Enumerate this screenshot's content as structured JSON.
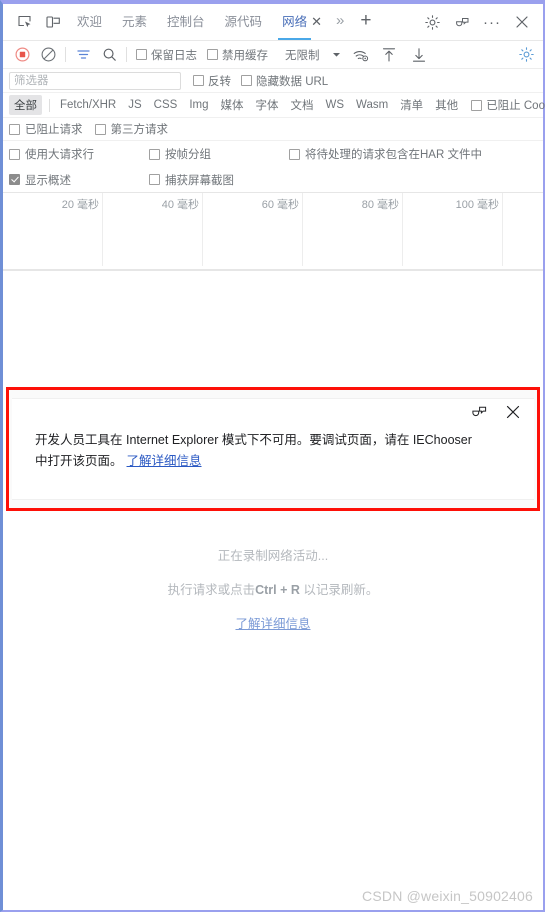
{
  "window": {
    "tabbar": {
      "inspect_icon": "inspect-element-icon",
      "device_icon": "device-emulation-icon",
      "tabs": [
        {
          "label": "欢迎",
          "active": false
        },
        {
          "label": "元素",
          "active": false
        },
        {
          "label": "控制台",
          "active": false
        },
        {
          "label": "源代码",
          "active": false
        },
        {
          "label": "网络",
          "active": true
        }
      ],
      "close_tab_glyph": "✕",
      "more_tabs_glyph": "»",
      "add_tab_glyph": "+",
      "settings_icon": "gear-icon",
      "feedback_icon": "feedback-icon",
      "overflow_glyph": "···",
      "close_glyph": "✕"
    },
    "network_toolbar": {
      "record_icon": "record-stop-icon",
      "clear_icon": "clear-icon",
      "filter_icon": "filter-icon",
      "search_icon": "search-icon",
      "preserve_log": {
        "label": "保留日志",
        "checked": false
      },
      "disable_cache": {
        "label": "禁用缓存",
        "checked": false
      },
      "throttling": {
        "value": "无限制",
        "caret": "▼"
      },
      "throttle_settings_icon": "network-conditions-icon",
      "import_icon": "import-har-icon",
      "export_icon": "export-har-icon",
      "settings_icon": "settings-gear-icon"
    },
    "filter_row": {
      "placeholder": "筛选器",
      "value": "",
      "invert": {
        "label": "反转",
        "checked": false
      },
      "hide_data_urls": {
        "label": "隐藏数据 URL",
        "checked": false
      }
    },
    "type_filters": {
      "chips": [
        {
          "label": "全部",
          "selected": true
        },
        {
          "label": "Fetch/XHR",
          "selected": false
        },
        {
          "label": "JS",
          "selected": false
        },
        {
          "label": "CSS",
          "selected": false
        },
        {
          "label": "Img",
          "selected": false
        },
        {
          "label": "媒体",
          "selected": false
        },
        {
          "label": "字体",
          "selected": false
        },
        {
          "label": "文档",
          "selected": false
        },
        {
          "label": "WS",
          "selected": false
        },
        {
          "label": "Wasm",
          "selected": false
        },
        {
          "label": "清单",
          "selected": false
        },
        {
          "label": "其他",
          "selected": false
        }
      ],
      "blocked_cookies": {
        "label": "已阻止 Cookie",
        "checked": false
      }
    },
    "option_rows": [
      {
        "items": [
          {
            "label": "已阻止请求",
            "checked": false
          },
          {
            "label": "第三方请求",
            "checked": false
          }
        ]
      },
      {
        "items": [
          {
            "label": "使用大请求行",
            "checked": false
          },
          {
            "label": "按帧分组",
            "checked": false
          },
          {
            "label": "将待处理的请求包含在HAR 文件中",
            "checked": false
          }
        ]
      },
      {
        "items": [
          {
            "label": "显示概述",
            "checked": true
          },
          {
            "label": "捕获屏幕截图",
            "checked": false
          }
        ]
      }
    ],
    "overview": {
      "ticks": [
        "20 毫秒",
        "40 毫秒",
        "60 毫秒",
        "80 毫秒",
        "100 毫秒"
      ]
    },
    "banner": {
      "message": "开发人员工具在 Internet Explorer 模式下不可用。要调试页面，请在 IEChooser 中打开该页面。",
      "link": "了解详细信息",
      "feedback_icon": "feedback-icon",
      "close_icon": "close-icon",
      "border_color": "#fd1008"
    },
    "empty_state": {
      "line1": "正在录制网络活动...",
      "line2_prefix": "执行请求或点击",
      "line2_shortcut": "Ctrl + R",
      "line2_suffix": " 以记录刷新。",
      "link": "了解详细信息"
    },
    "watermark": "CSDN @weixin_50902406"
  }
}
